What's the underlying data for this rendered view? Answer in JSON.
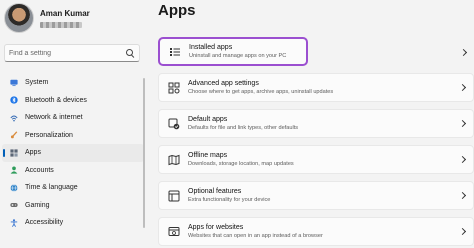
{
  "user": {
    "name": "Aman Kumar"
  },
  "search": {
    "placeholder": "Find a setting"
  },
  "sidebar": {
    "items": [
      {
        "label": "System",
        "icon": "system-icon",
        "color": "#3b78d8"
      },
      {
        "label": "Bluetooth & devices",
        "icon": "bluetooth-icon",
        "color": "#1a73e8"
      },
      {
        "label": "Network & internet",
        "icon": "network-icon",
        "color": "#3b6fb6"
      },
      {
        "label": "Personalization",
        "icon": "brush-icon",
        "color": "#d98a3a"
      },
      {
        "label": "Apps",
        "icon": "apps-icon",
        "color": "#5b6675",
        "active": true
      },
      {
        "label": "Accounts",
        "icon": "accounts-icon",
        "color": "#2e9c5b"
      },
      {
        "label": "Time & language",
        "icon": "globe-icon",
        "color": "#2f83c8"
      },
      {
        "label": "Gaming",
        "icon": "gaming-icon",
        "color": "#6b6b6b"
      },
      {
        "label": "Accessibility",
        "icon": "accessibility-icon",
        "color": "#2f6fd0"
      }
    ]
  },
  "page": {
    "title": "Apps"
  },
  "cards": [
    {
      "title": "Installed apps",
      "subtitle": "Uninstall and manage apps on your PC",
      "icon": "list-icon"
    },
    {
      "title": "Advanced app settings",
      "subtitle": "Choose where to get apps, archive apps, uninstall updates",
      "icon": "advanced-apps-icon"
    },
    {
      "title": "Default apps",
      "subtitle": "Defaults for file and link types, other defaults",
      "icon": "default-apps-icon"
    },
    {
      "title": "Offline maps",
      "subtitle": "Downloads, storage location, map updates",
      "icon": "map-icon"
    },
    {
      "title": "Optional features",
      "subtitle": "Extra functionality for your device",
      "icon": "optional-features-icon"
    },
    {
      "title": "Apps for websites",
      "subtitle": "Websites that can open in an app instead of a browser",
      "icon": "web-apps-icon"
    }
  ],
  "colors": {
    "accent": "#005fb8",
    "highlight": "#9b4fd0"
  }
}
